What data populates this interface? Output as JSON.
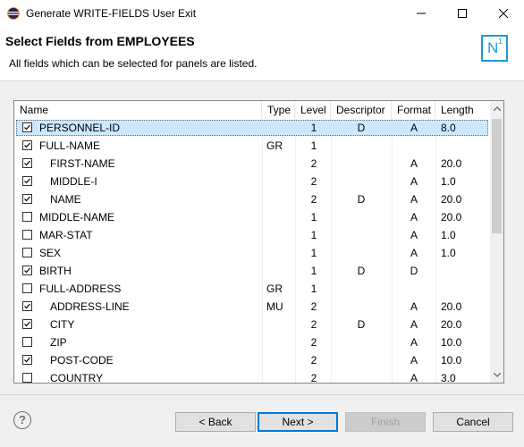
{
  "window": {
    "title": "Generate WRITE-FIELDS User Exit"
  },
  "header": {
    "title": "Select Fields from EMPLOYEES",
    "description": "All fields which can be selected for panels are listed.",
    "badge_text": "N",
    "badge_sup": "1"
  },
  "table": {
    "columns": [
      "Name",
      "Type",
      "Level",
      "Descriptor",
      "Format",
      "Length"
    ],
    "rows": [
      {
        "checked": true,
        "name": "PERSONNEL-ID",
        "type": "",
        "level": "1",
        "descriptor": "D",
        "format": "A",
        "length": "8.0",
        "selected": true
      },
      {
        "checked": true,
        "name": "FULL-NAME",
        "type": "GR",
        "level": "1",
        "descriptor": "",
        "format": "",
        "length": ""
      },
      {
        "checked": true,
        "name": "FIRST-NAME",
        "type": "",
        "level": "2",
        "descriptor": "",
        "format": "A",
        "length": "20.0"
      },
      {
        "checked": true,
        "name": "MIDDLE-I",
        "type": "",
        "level": "2",
        "descriptor": "",
        "format": "A",
        "length": "1.0"
      },
      {
        "checked": true,
        "name": "NAME",
        "type": "",
        "level": "2",
        "descriptor": "D",
        "format": "A",
        "length": "20.0"
      },
      {
        "checked": false,
        "name": "MIDDLE-NAME",
        "type": "",
        "level": "1",
        "descriptor": "",
        "format": "A",
        "length": "20.0"
      },
      {
        "checked": false,
        "name": "MAR-STAT",
        "type": "",
        "level": "1",
        "descriptor": "",
        "format": "A",
        "length": "1.0"
      },
      {
        "checked": false,
        "name": "SEX",
        "type": "",
        "level": "1",
        "descriptor": "",
        "format": "A",
        "length": "1.0"
      },
      {
        "checked": true,
        "name": "BIRTH",
        "type": "",
        "level": "1",
        "descriptor": "D",
        "format": "D",
        "length": ""
      },
      {
        "checked": false,
        "name": "FULL-ADDRESS",
        "type": "GR",
        "level": "1",
        "descriptor": "",
        "format": "",
        "length": ""
      },
      {
        "checked": true,
        "name": "ADDRESS-LINE",
        "type": "MU",
        "level": "2",
        "descriptor": "",
        "format": "A",
        "length": "20.0"
      },
      {
        "checked": true,
        "name": "CITY",
        "type": "",
        "level": "2",
        "descriptor": "D",
        "format": "A",
        "length": "20.0"
      },
      {
        "checked": false,
        "name": "ZIP",
        "type": "",
        "level": "2",
        "descriptor": "",
        "format": "A",
        "length": "10.0"
      },
      {
        "checked": true,
        "name": "POST-CODE",
        "type": "",
        "level": "2",
        "descriptor": "",
        "format": "A",
        "length": "10.0"
      },
      {
        "checked": false,
        "name": "COUNTRY",
        "type": "",
        "level": "2",
        "descriptor": "",
        "format": "A",
        "length": "3.0"
      }
    ]
  },
  "buttons": {
    "help": "?",
    "back": "< Back",
    "next": "Next >",
    "finish": "Finish",
    "cancel": "Cancel"
  },
  "colors": {
    "accent": "#0078d7",
    "selection": "#cce8ff",
    "badge": "#1f9ad6"
  },
  "icons": [
    "app-icon",
    "minimize-icon",
    "maximize-icon",
    "close-icon",
    "checkbox-check-icon",
    "scroll-up-icon",
    "scroll-down-icon",
    "help-icon"
  ]
}
